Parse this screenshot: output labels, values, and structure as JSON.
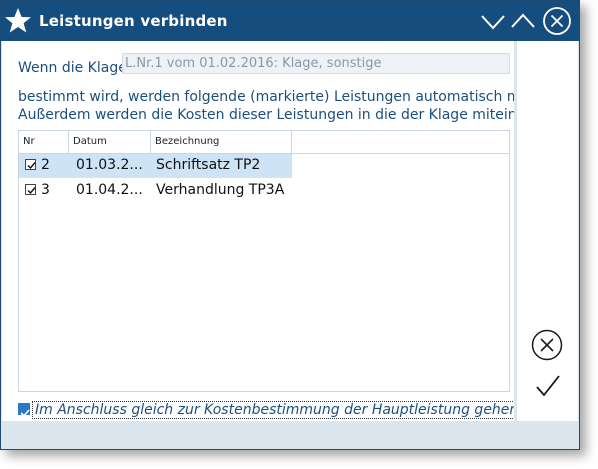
{
  "window": {
    "title": "Leistungen verbinden",
    "accent_color": "#154e7e",
    "icons": {
      "app": "star-icon",
      "minimize": "chevron-down-icon",
      "maximize": "chevron-up-icon",
      "close": "close-circle-icon"
    }
  },
  "form": {
    "klage_label": "Wenn die Klage",
    "klage_value": "L.Nr.1 vom 01.02.2016: Klage, sonstige",
    "info_line1": "bestimmt wird, werden folgende (markierte) Leistungen automatisch mit",
    "info_line2": "Außerdem werden die Kosten dieser Leistungen in die der Klage miteinbe"
  },
  "table": {
    "columns": [
      "Nr",
      "Datum",
      "Bezeichnung"
    ],
    "rows": [
      {
        "checked": true,
        "nr": "2",
        "datum": "01.03.2...",
        "bezeichnung": "Schriftsatz TP2",
        "selected": true
      },
      {
        "checked": true,
        "nr": "3",
        "datum": "01.04.2...",
        "bezeichnung": "Verhandlung TP3A",
        "selected": false
      }
    ]
  },
  "footer": {
    "checked": true,
    "label": "Im Anschluss gleich zur Kostenbestimmung der Hauptleistung gehen"
  },
  "actions": {
    "cancel_icon": "cancel-circle-icon",
    "ok_icon": "checkmark-icon"
  }
}
